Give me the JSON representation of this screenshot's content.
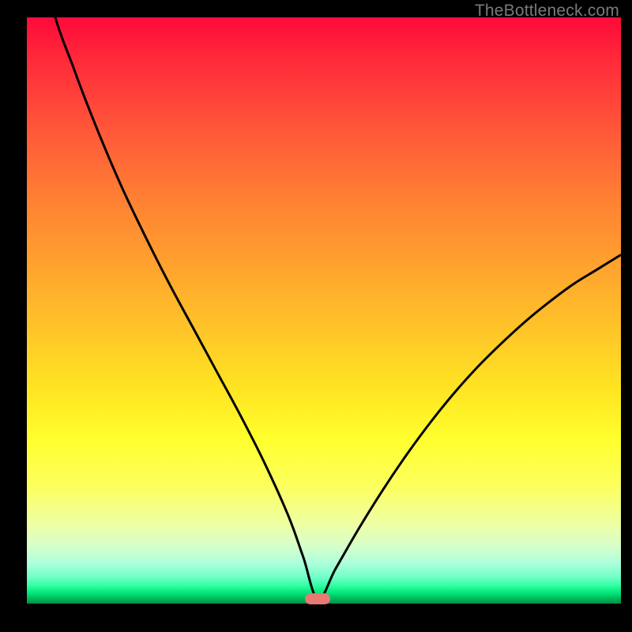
{
  "watermark": "TheBottleneck.com",
  "colors": {
    "frame": "#000000",
    "marker": "#e77b74",
    "curve": "#000000"
  },
  "chart_data": {
    "type": "line",
    "title": "",
    "xlabel": "",
    "ylabel": "",
    "xlim": [
      0,
      100
    ],
    "ylim": [
      0,
      100
    ],
    "x": [
      0,
      4,
      8,
      12,
      16,
      20,
      24,
      28,
      32,
      36,
      40,
      44,
      46.5,
      49,
      52,
      56,
      60,
      64,
      68,
      72,
      76,
      80,
      84,
      88,
      92,
      96,
      100
    ],
    "values": [
      124,
      103,
      91,
      80.5,
      71,
      62.5,
      54.5,
      47,
      39.5,
      32,
      24,
      15,
      8,
      0.8,
      6,
      13,
      19.5,
      25.5,
      31,
      36,
      40.5,
      44.5,
      48.2,
      51.5,
      54.5,
      57,
      59.5
    ],
    "marker": {
      "x": 49,
      "y": 0.8
    },
    "notes": "Single black V-shaped curve over rainbow gradient; minimum at approximately x=49% near the green baseline; left branch exits top edge. Values are percentages of the plot area height from the bottom edge."
  }
}
